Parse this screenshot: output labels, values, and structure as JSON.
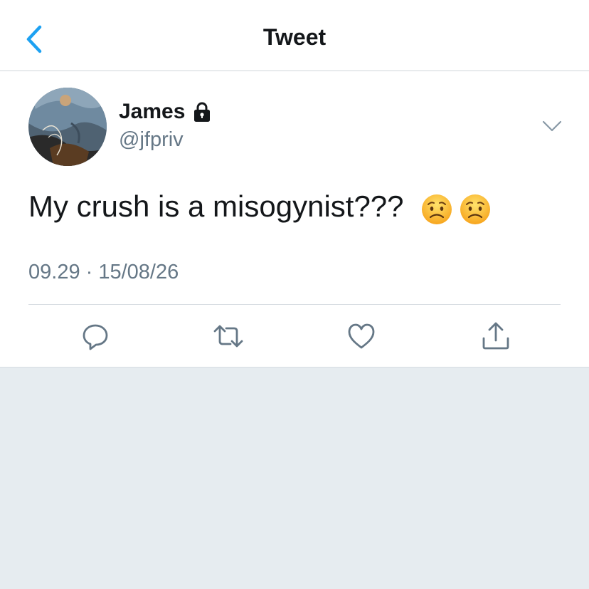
{
  "header": {
    "title": "Tweet",
    "back_icon": "chevron-left-icon"
  },
  "tweet": {
    "author": {
      "display_name": "James",
      "handle": "@jfpriv",
      "protected_icon": "lock-icon"
    },
    "text": "My crush is a misogynist???",
    "emojis": [
      "worried-face",
      "worried-face"
    ],
    "timestamp": "09.29 · 15/08/26",
    "menu_icon": "chevron-down-icon"
  },
  "actions": [
    {
      "name": "reply",
      "icon": "reply-icon"
    },
    {
      "name": "retweet",
      "icon": "retweet-icon"
    },
    {
      "name": "like",
      "icon": "heart-icon"
    },
    {
      "name": "share",
      "icon": "share-icon"
    }
  ],
  "colors": {
    "accent": "#1da1f2",
    "text": "#14171a",
    "secondary_text": "#657786",
    "icon_gray": "#657786",
    "background": "#e6ecf0"
  }
}
